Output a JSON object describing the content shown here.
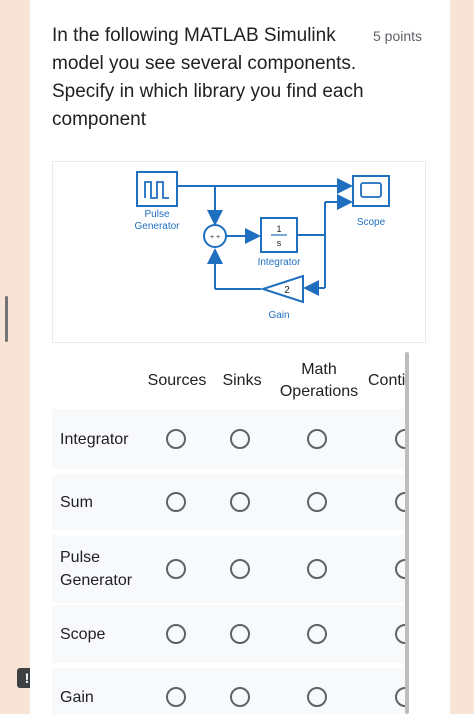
{
  "question": {
    "text": "In the following MATLAB Simulink\nmodel you see several components.\nSpecify in which library you find each\ncomponent",
    "points": "5 points"
  },
  "diagram": {
    "pulse_label_1": "Pulse",
    "pulse_label_2": "Generator",
    "scope_label": "Scope",
    "integrator_num": "1",
    "integrator_den": "s",
    "integrator_label": "Integrator",
    "gain_value": "2",
    "gain_label": "Gain",
    "sum_signs": "+ +"
  },
  "grid": {
    "columns": [
      "Sources",
      "Sinks",
      "Math\nOperations",
      "Continu"
    ],
    "rows": [
      "Integrator",
      "Sum",
      "Pulse\nGenerator",
      "Scope",
      "Gain"
    ]
  },
  "colors": {
    "accent_blue": "#1f6fbf",
    "page_bg": "#f7e4d6"
  }
}
